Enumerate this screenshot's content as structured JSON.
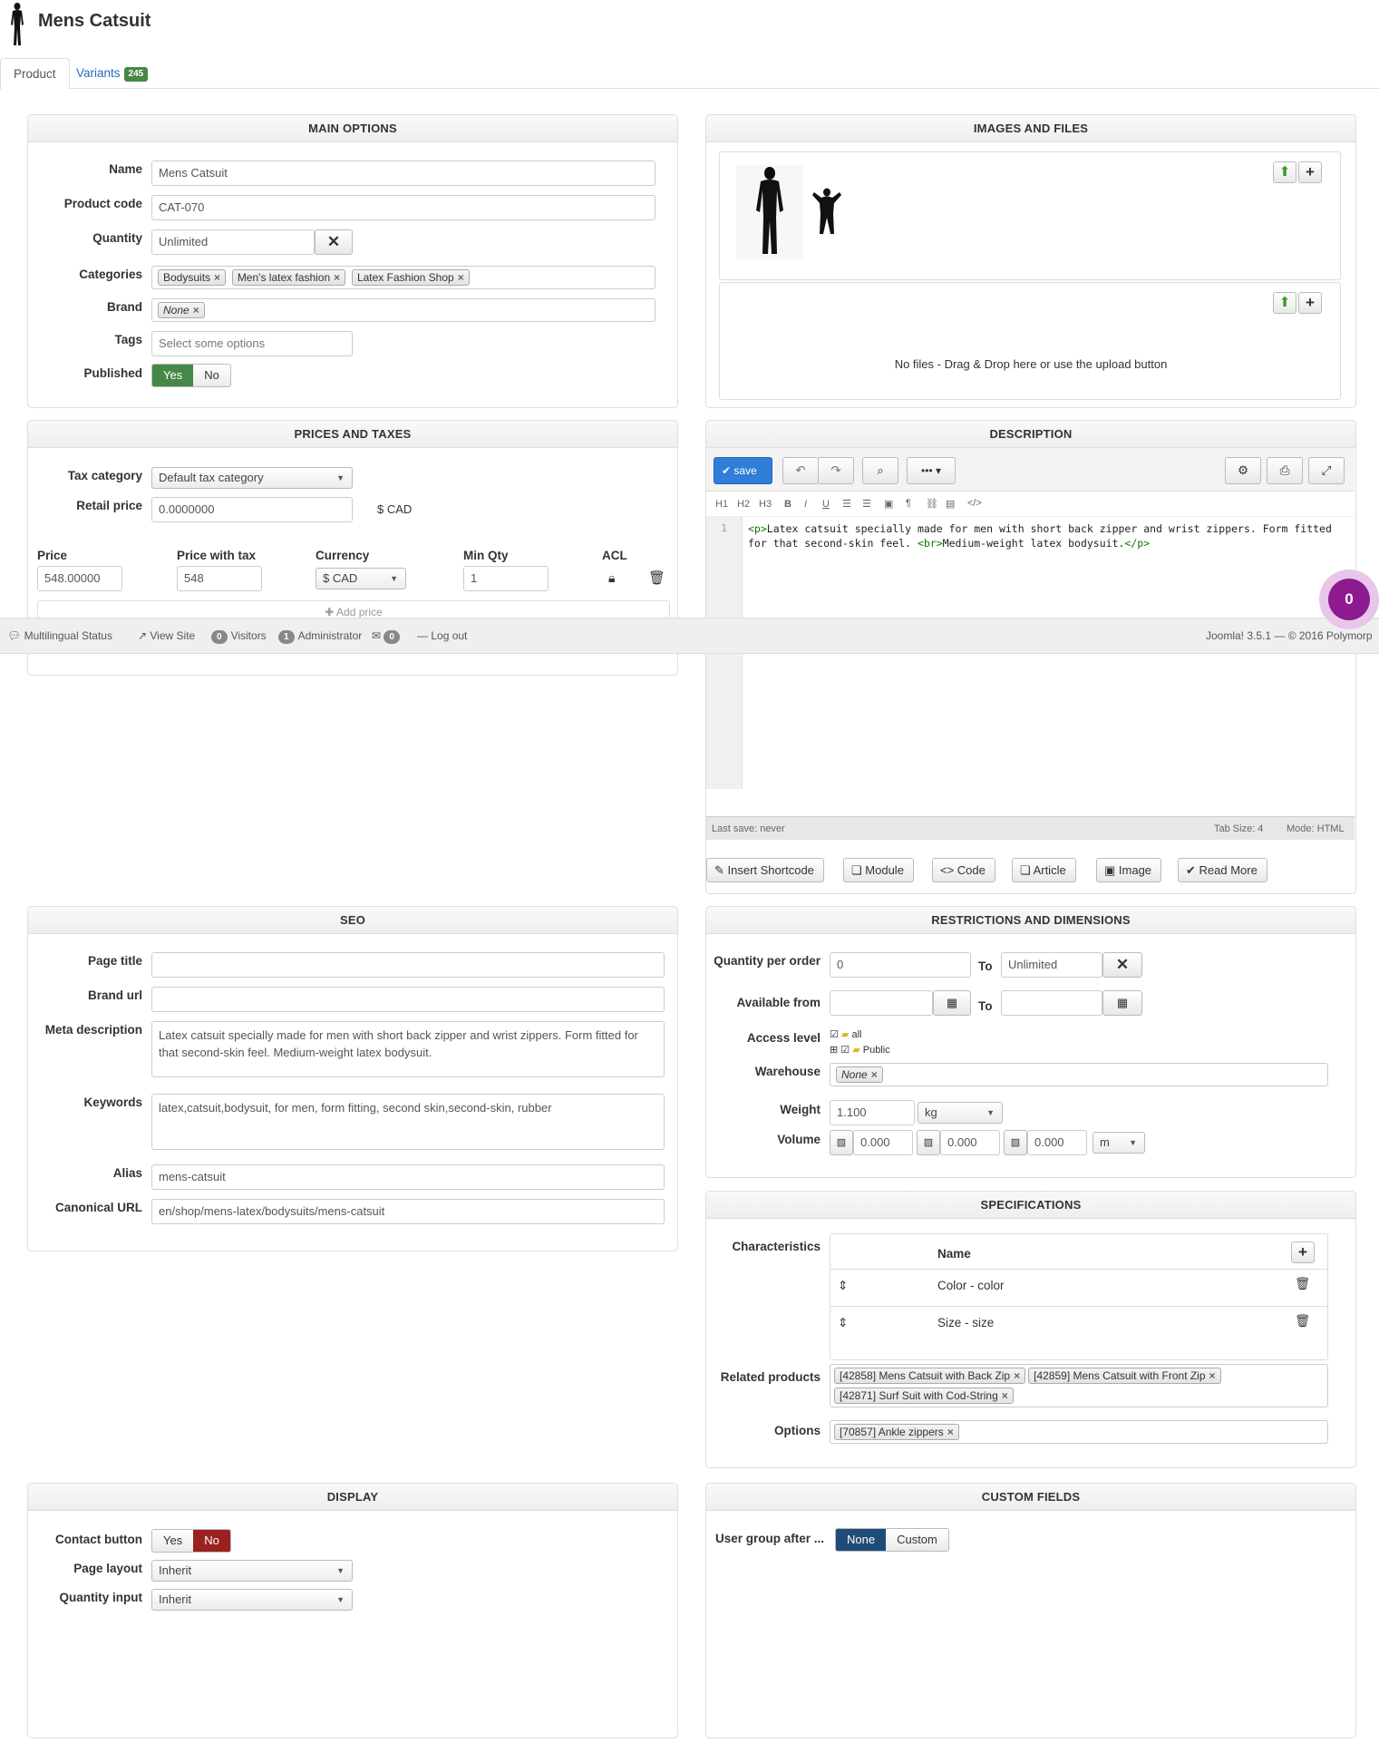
{
  "header": {
    "title": "Mens Catsuit"
  },
  "tabs": [
    {
      "label": "Product"
    },
    {
      "label": "Variants",
      "badge": "245"
    }
  ],
  "main_options": {
    "title": "MAIN OPTIONS",
    "name_label": "Name",
    "name_value": "Mens Catsuit",
    "code_label": "Product code",
    "code_value": "CAT-070",
    "qty_label": "Quantity",
    "qty_value": "Unlimited",
    "cat_label": "Categories",
    "categories": [
      "Bodysuits",
      "Men's latex fashion",
      "Latex Fashion Shop"
    ],
    "brand_label": "Brand",
    "brand_value": "None",
    "tags_label": "Tags",
    "tags_placeholder": "Select some options",
    "published_label": "Published",
    "yes": "Yes",
    "no": "No"
  },
  "prices": {
    "title": "PRICES AND TAXES",
    "tax_label": "Tax category",
    "tax_value": "Default tax category",
    "retail_label": "Retail price",
    "retail_value": "0.0000000",
    "retail_unit": "$ CAD",
    "col_price": "Price",
    "col_price_tax": "Price with tax",
    "col_currency": "Currency",
    "col_minqty": "Min Qty",
    "col_acl": "ACL",
    "price": "548.00000",
    "price_tax": "548",
    "currency": "$ CAD",
    "minqty": "1",
    "add_price": "Add price"
  },
  "status_bar": {
    "multilingual": "Multilingual Status",
    "view_site": "View Site",
    "visitors_count": "0",
    "visitors": "Visitors",
    "admin_count": "1",
    "admin": "Administrator",
    "msg_count": "0",
    "logout": "Log out",
    "version": "Joomla! 3.5.1 — © 2016 Polymorp",
    "bubble": "0"
  },
  "images": {
    "title": "IMAGES AND FILES",
    "no_files": "No files - Drag & Drop here or use the upload button"
  },
  "description": {
    "title": "DESCRIPTION",
    "save": "save",
    "fmt": [
      "H1",
      "H2",
      "H3",
      "B",
      "I",
      "U"
    ],
    "line_no": "1",
    "code_1a": "<p>",
    "code_1b": "Latex catsuit specially made for men with short back zipper and wrist zippers. Form fitted",
    "code_2a": "for that second-skin feel. ",
    "code_2b": "<br>",
    "code_2c": "Medium-weight latex bodysuit.",
    "code_2d": "</p>",
    "last_save": "Last save: never",
    "tab_size": "Tab Size: 4",
    "mode": "Mode: HTML",
    "buttons": [
      "Insert Shortcode",
      "Module",
      "Code",
      "Article",
      "Image",
      "Read More"
    ]
  },
  "seo": {
    "title": "SEO",
    "page_title_label": "Page title",
    "page_title": "",
    "brand_url_label": "Brand url",
    "brand_url": "",
    "meta_label": "Meta description",
    "meta": "Latex catsuit specially made for men with short back zipper and wrist zippers. Form fitted for that second-skin feel. Medium-weight latex bodysuit.",
    "keywords_label": "Keywords",
    "keywords": "latex,catsuit,bodysuit, for men, form fitting, second skin,second-skin, rubber",
    "alias_label": "Alias",
    "alias": "mens-catsuit",
    "canonical_label": "Canonical URL",
    "canonical": "en/shop/mens-latex/bodysuits/mens-catsuit"
  },
  "restrictions": {
    "title": "RESTRICTIONS AND DIMENSIONS",
    "qpo_label": "Quantity per order",
    "qpo_from": "0",
    "to": "To",
    "qpo_to": "Unlimited",
    "avail_label": "Available from",
    "access_label": "Access level",
    "access_all": "all",
    "access_public": "Public",
    "warehouse_label": "Warehouse",
    "warehouse": "None",
    "weight_label": "Weight",
    "weight": "1.100",
    "weight_unit": "kg",
    "volume_label": "Volume",
    "vol1": "0.000",
    "vol2": "0.000",
    "vol3": "0.000",
    "vol_unit": "m"
  },
  "specs": {
    "title": "SPECIFICATIONS",
    "char_label": "Characteristics",
    "name_col": "Name",
    "chars": [
      "Color - color",
      "Size - size"
    ],
    "related_label": "Related products",
    "related": [
      "[42858] Mens Catsuit with Back Zip",
      "[42859] Mens Catsuit with Front Zip",
      "[42871] Surf Suit with Cod-String"
    ],
    "options_label": "Options",
    "options": [
      "[70857] Ankle zippers"
    ]
  },
  "display": {
    "title": "DISPLAY",
    "contact_label": "Contact button",
    "yes": "Yes",
    "no": "No",
    "layout_label": "Page layout",
    "layout": "Inherit",
    "qtyinput_label": "Quantity input",
    "qtyinput": "Inherit"
  },
  "custom": {
    "title": "CUSTOM FIELDS",
    "ug_label": "User group after ...",
    "none": "None",
    "custom": "Custom"
  }
}
